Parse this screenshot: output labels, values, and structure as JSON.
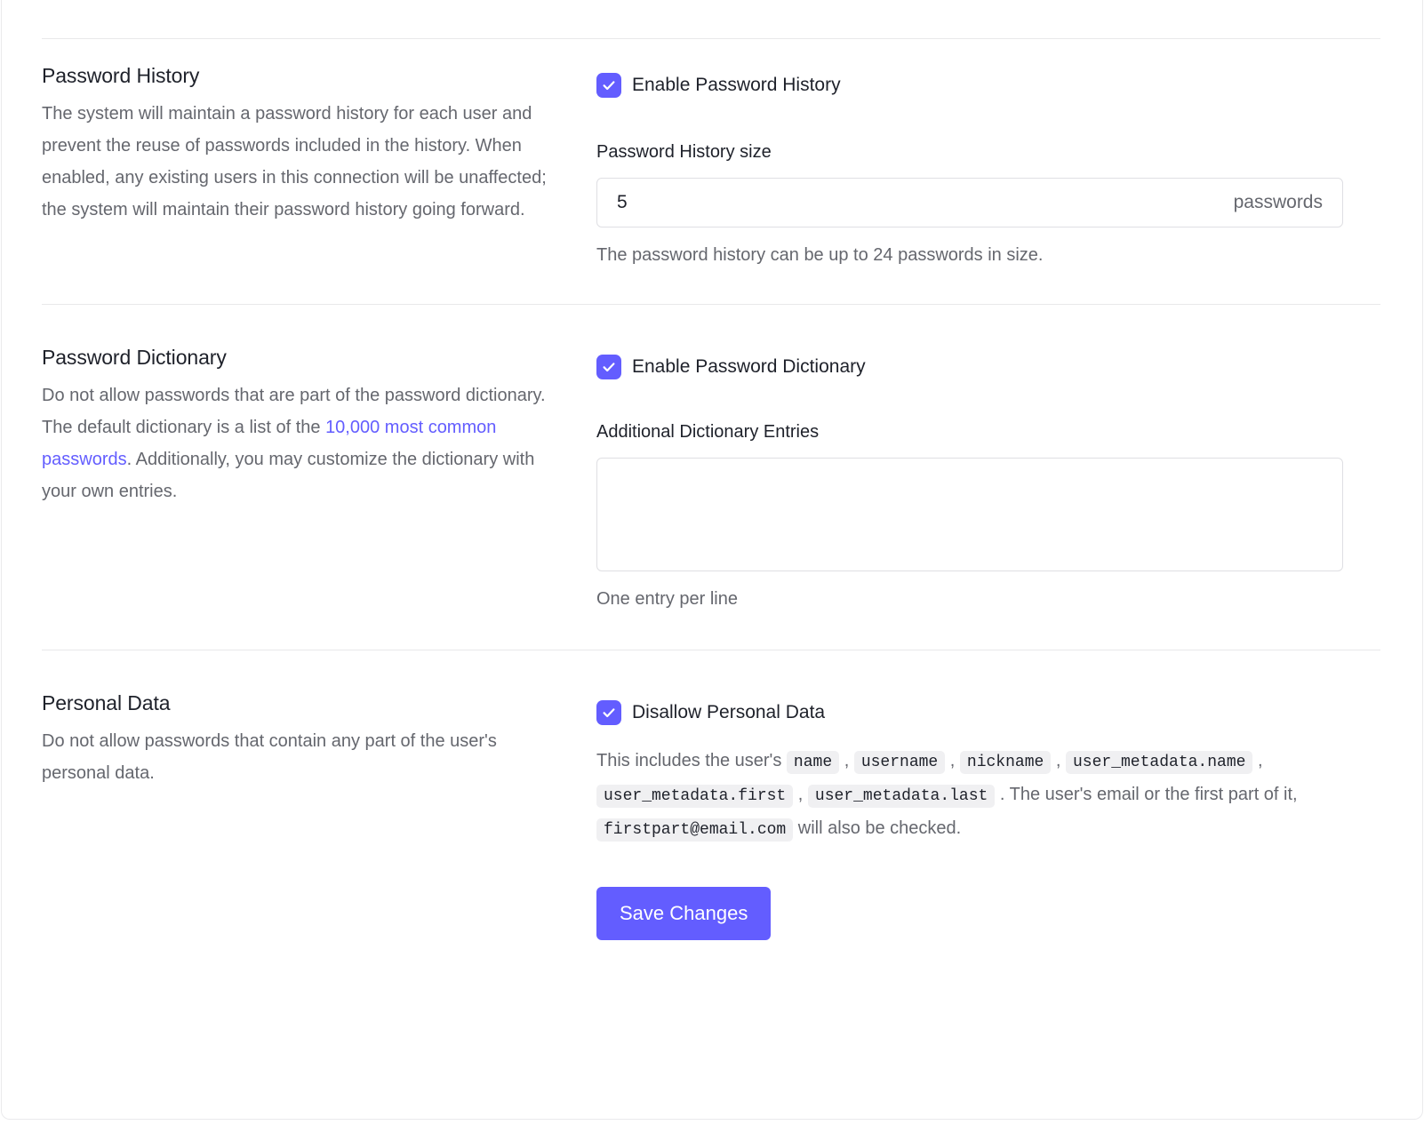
{
  "theme": {
    "accent": "#635DFF",
    "text_primary": "#1E212A",
    "text_secondary": "#65676E",
    "border": "#DFDFE3",
    "divider": "#E8E8EA",
    "chip_bg": "#F0F0F2"
  },
  "sections": {
    "password_history": {
      "title": "Password History",
      "description": "The system will maintain a password history for each user and prevent the reuse of passwords included in the history. When enabled, any existing users in this connection will be unaffected; the system will maintain their password history going forward.",
      "checkbox_label": "Enable Password History",
      "checkbox_checked": true,
      "field_label": "Password History size",
      "field_value": "5",
      "field_placeholder": "",
      "field_suffix": "passwords",
      "helper_text": "The password history can be up to 24 passwords in size."
    },
    "password_dictionary": {
      "title": "Password Dictionary",
      "description_part1": "Do not allow passwords that are part of the password dictionary. The default dictionary is a list of the ",
      "link_text": "10,000 most common passwords",
      "description_part2": ". Additionally, you may customize the dictionary with your own entries.",
      "checkbox_label": "Enable Password Dictionary",
      "checkbox_checked": true,
      "field_label": "Additional Dictionary Entries",
      "field_value": "",
      "field_placeholder": "",
      "helper_text": "One entry per line"
    },
    "personal_data": {
      "title": "Personal Data",
      "description": "Do not allow passwords that contain any part of the user's personal data.",
      "checkbox_label": "Disallow Personal Data",
      "checkbox_checked": true,
      "note_part1": "This includes the user's ",
      "note_chips_group1": [
        "name",
        "username",
        "nickname",
        "user_metadata.name"
      ],
      "note_chips_group2": [
        "user_metadata.first",
        "user_metadata.last"
      ],
      "note_part2": ". The user's email or the first part of it, ",
      "note_chip_email": "firstpart@email.com",
      "note_part3": " will also be checked."
    }
  },
  "actions": {
    "save_label": "Save Changes"
  },
  "icons": {
    "checkmark": "check-icon"
  }
}
